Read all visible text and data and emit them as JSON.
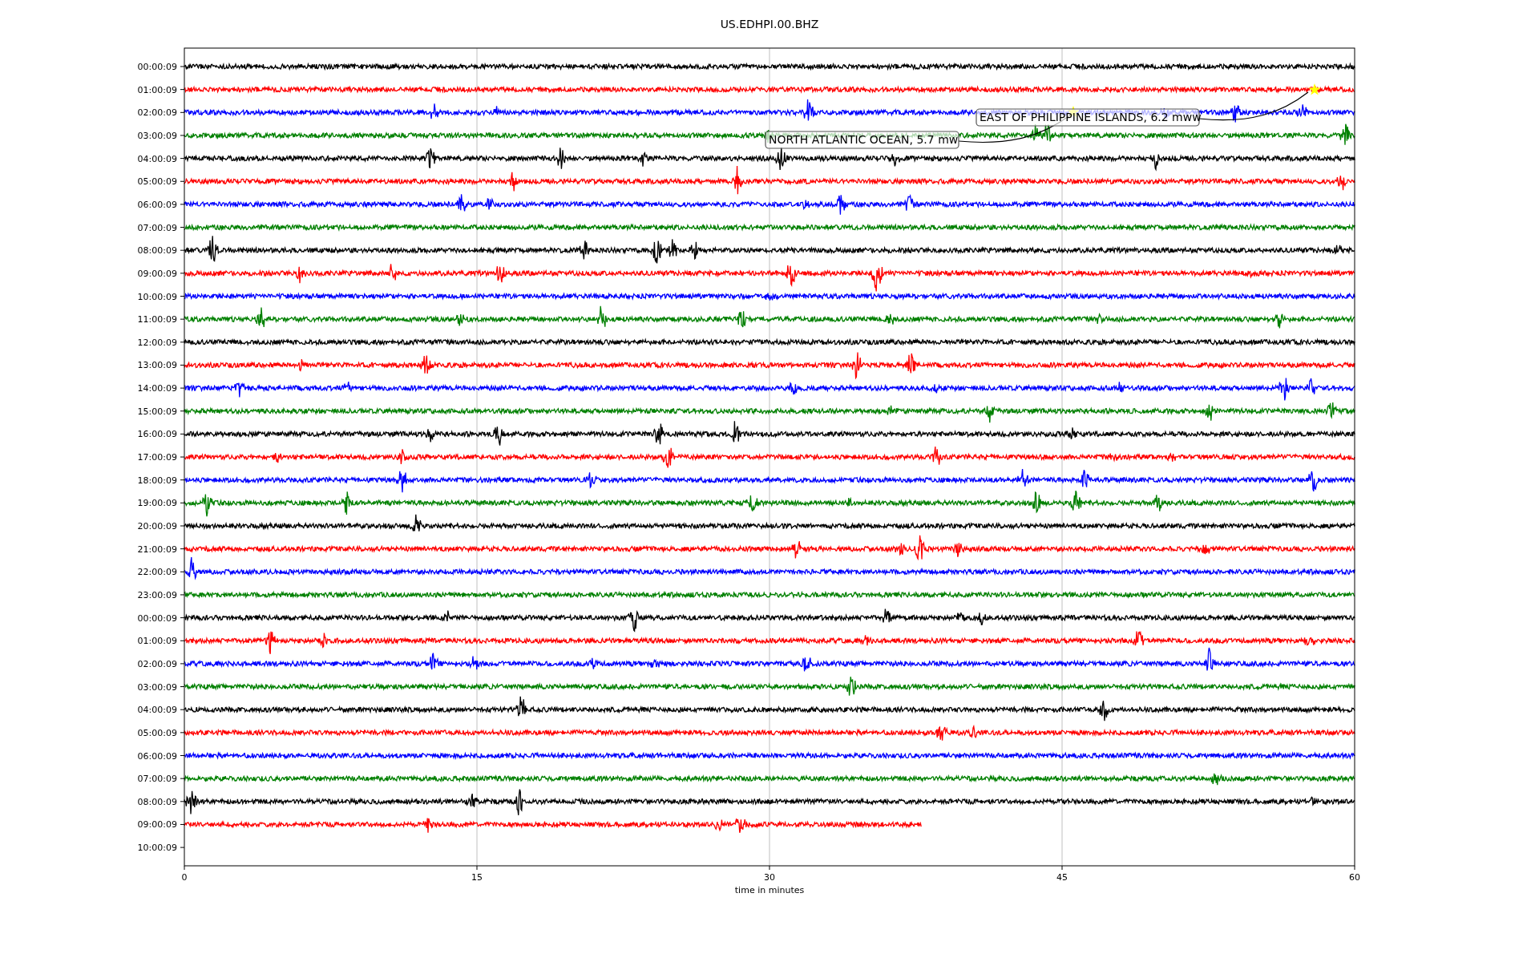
{
  "figure": {
    "title": "US.EDHPI.00.BHZ"
  },
  "x_axis": {
    "label": "time in minutes",
    "ticks": [
      "0",
      "15",
      "30",
      "45",
      "60"
    ]
  },
  "traces": [
    {
      "label": "00:00:09",
      "color": "#000000",
      "level": 1
    },
    {
      "label": "01:00:09",
      "color": "#ff0000",
      "level": 1
    },
    {
      "label": "02:00:09",
      "color": "#0000ff",
      "level": 1
    },
    {
      "label": "03:00:09",
      "color": "#008000",
      "level": 1
    },
    {
      "label": "04:00:09",
      "color": "#000000",
      "level": 1
    },
    {
      "label": "05:00:09",
      "color": "#ff0000",
      "level": 1
    },
    {
      "label": "06:00:09",
      "color": "#0000ff",
      "level": 1
    },
    {
      "label": "07:00:09",
      "color": "#008000",
      "level": 1
    },
    {
      "label": "08:00:09",
      "color": "#000000",
      "level": 1
    },
    {
      "label": "09:00:09",
      "color": "#ff0000",
      "level": 1
    },
    {
      "label": "10:00:09",
      "color": "#0000ff",
      "level": 1
    },
    {
      "label": "11:00:09",
      "color": "#008000",
      "level": 1
    },
    {
      "label": "12:00:09",
      "color": "#000000",
      "level": 1
    },
    {
      "label": "13:00:09",
      "color": "#ff0000",
      "level": 1
    },
    {
      "label": "14:00:09",
      "color": "#0000ff",
      "level": 1
    },
    {
      "label": "15:00:09",
      "color": "#008000",
      "level": 1
    },
    {
      "label": "16:00:09",
      "color": "#000000",
      "level": 1
    },
    {
      "label": "17:00:09",
      "color": "#ff0000",
      "level": 1
    },
    {
      "label": "18:00:09",
      "color": "#0000ff",
      "level": 1
    },
    {
      "label": "19:00:09",
      "color": "#008000",
      "level": 1
    },
    {
      "label": "20:00:09",
      "color": "#000000",
      "level": 1
    },
    {
      "label": "21:00:09",
      "color": "#ff0000",
      "level": 1
    },
    {
      "label": "22:00:09",
      "color": "#0000ff",
      "level": 1
    },
    {
      "label": "23:00:09",
      "color": "#008000",
      "level": 1
    },
    {
      "label": "00:00:09",
      "color": "#000000",
      "level": 1
    },
    {
      "label": "01:00:09",
      "color": "#ff0000",
      "level": 1
    },
    {
      "label": "02:00:09",
      "color": "#0000ff",
      "level": 1
    },
    {
      "label": "03:00:09",
      "color": "#008000",
      "level": 1
    },
    {
      "label": "04:00:09",
      "color": "#000000",
      "level": 1
    },
    {
      "label": "05:00:09",
      "color": "#ff0000",
      "level": 1
    },
    {
      "label": "06:00:09",
      "color": "#0000ff",
      "level": 1
    },
    {
      "label": "07:00:09",
      "color": "#008000",
      "level": 1
    },
    {
      "label": "08:00:09",
      "color": "#000000",
      "level": 1
    },
    {
      "label": "09:00:09",
      "color": "#ff0000",
      "level": 0.63
    },
    {
      "label": "10:00:09"
    }
  ],
  "events": [
    {
      "label": "EAST OF PHILIPPINE ISLANDS, 6.2 mww"
    },
    {
      "label": "NORTH ATLANTIC OCEAN, 5.7 mw"
    }
  ]
}
